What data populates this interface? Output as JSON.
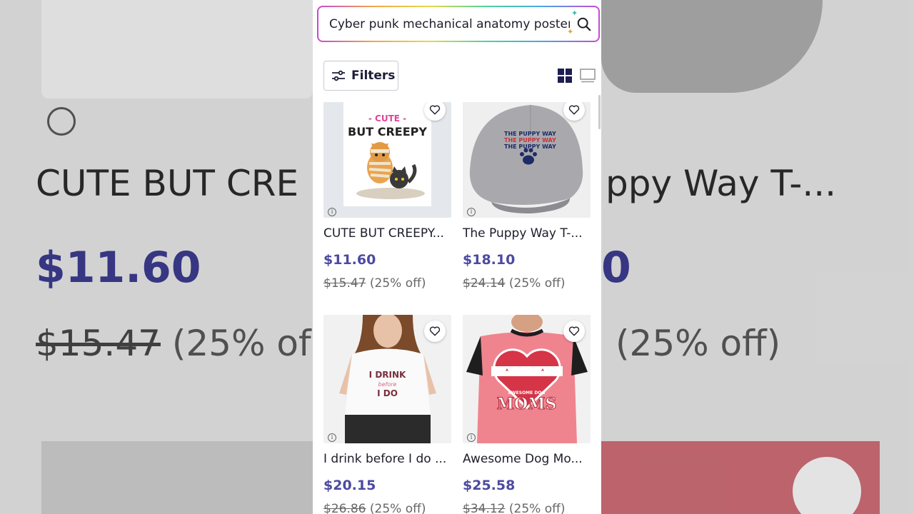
{
  "search": {
    "query": "Cyber punk mechanical anatomy posters"
  },
  "toolbar": {
    "filters_label": "Filters"
  },
  "products": [
    {
      "title": "CUTE BUT CREEPY...",
      "price": "$11.60",
      "original_price": "$15.47",
      "discount": "(25% off)",
      "image_text": [
        "- CUTE -",
        "BUT CREEPY"
      ]
    },
    {
      "title": "The Puppy Way T-...",
      "price": "$18.10",
      "original_price": "$24.14",
      "discount": "(25% off)",
      "image_text": [
        "THE PUPPY WAY",
        "THE PUPPY WAY",
        "THE PUPPY WAY"
      ]
    },
    {
      "title": "I drink before I do ...",
      "price": "$20.15",
      "original_price": "$26.86",
      "discount": "(25% off)",
      "image_text": [
        "I DRINK",
        "before",
        "I DO"
      ]
    },
    {
      "title": "Awesome Dog Mo...",
      "price": "$25.58",
      "original_price": "$34.12",
      "discount": "(25% off)",
      "image_text": [
        "AWESOME DOG",
        "MOMS"
      ]
    }
  ],
  "background": {
    "left_title": "CUTE BUT CRE",
    "left_price": "$11.60",
    "left_orig": "$15.47",
    "left_discount": "(25% of",
    "right_title": "ppy Way T-...",
    "right_price": "0",
    "right_discount": "(25% off)"
  },
  "colors": {
    "price": "#4c4aa0",
    "accent_dark": "#1d1d3b",
    "view_active": "#1e1e52"
  }
}
